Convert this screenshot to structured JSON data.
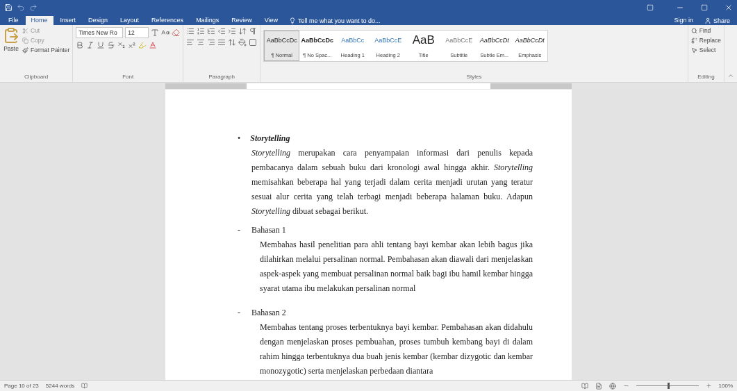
{
  "window": {
    "tell_me": "Tell me what you want to do...",
    "sign_in": "Sign in",
    "share": "Share"
  },
  "tabs": [
    {
      "label": "File",
      "selected": false
    },
    {
      "label": "Home",
      "selected": true
    },
    {
      "label": "Insert",
      "selected": false
    },
    {
      "label": "Design",
      "selected": false
    },
    {
      "label": "Layout",
      "selected": false
    },
    {
      "label": "References",
      "selected": false
    },
    {
      "label": "Mailings",
      "selected": false
    },
    {
      "label": "Review",
      "selected": false
    },
    {
      "label": "View",
      "selected": false
    }
  ],
  "clipboard": {
    "paste": "Paste",
    "cut": "Cut",
    "copy": "Copy",
    "format_painter": "Format Painter",
    "label": "Clipboard"
  },
  "font": {
    "name": "Times New Ro",
    "size": "12",
    "label": "Font"
  },
  "paragraph": {
    "label": "Paragraph"
  },
  "styles": {
    "label": "Styles",
    "items": [
      {
        "preview": "AaBbCcDc",
        "name": "¶ Normal",
        "selected": true,
        "kind": "normal"
      },
      {
        "preview": "AaBbCcDc",
        "name": "¶ No Spac...",
        "selected": false,
        "kind": "strong"
      },
      {
        "preview": "AaBbCc",
        "name": "Heading 1",
        "selected": false,
        "kind": "heading"
      },
      {
        "preview": "AaBbCcE",
        "name": "Heading 2",
        "selected": false,
        "kind": "heading"
      },
      {
        "preview": "AaB",
        "name": "Title",
        "selected": false,
        "kind": "title"
      },
      {
        "preview": "AaBbCcE",
        "name": "Subtitle",
        "selected": false,
        "kind": "subtle"
      },
      {
        "preview": "AaBbCcDt",
        "name": "Subtle Em...",
        "selected": false,
        "kind": "italic"
      },
      {
        "preview": "AaBbCcDt",
        "name": "Emphasis",
        "selected": false,
        "kind": "italic"
      }
    ]
  },
  "editing": {
    "find": "Find",
    "replace": "Replace",
    "select": "Select",
    "label": "Editing"
  },
  "document": {
    "bullet": "•",
    "heading": "Storytelling",
    "intro": "*Storytelling* merupakan cara penyampaian informasi dari penulis kepada pembacanya dalam sebuah buku dari kronologi awal hingga akhir. *Storytelling* memisahkan beberapa hal yang terjadi dalam cerita menjadi urutan yang teratur sesuai alur cerita yang telah terbagi menjadi beberapa halaman buku. Adapun *Storytelling* dibuat sebagai berikut.",
    "sections": [
      {
        "marker": "-",
        "title": "Bahasan 1",
        "text": "Membahas hasil penelitian para ahli tentang bayi kembar akan lebih bagus jika dilahirkan melalui persalinan normal. Pembahasan akan diawali dari menjelaskan aspek-aspek yang membuat persalinan normal baik bagi ibu hamil kembar hingga syarat utama ibu melakukan persalinan normal"
      },
      {
        "marker": "-",
        "title": "Bahasan 2",
        "text": "Membahas tentang proses terbentuknya bayi kembar. Pembahasan akan didahulu dengan menjelaskan proses pembuahan, proses tumbuh kembang bayi di dalam rahim hingga terbentuknya dua buah jenis kembar (kembar dizygotic dan kembar monozygotic) serta menjelaskan perbedaan diantara"
      }
    ]
  },
  "status_bar": {
    "page": "Page 10 of 23",
    "words": "5244 words",
    "zoom": "100%",
    "zoom_level": {
      "level": 0.5
    }
  }
}
